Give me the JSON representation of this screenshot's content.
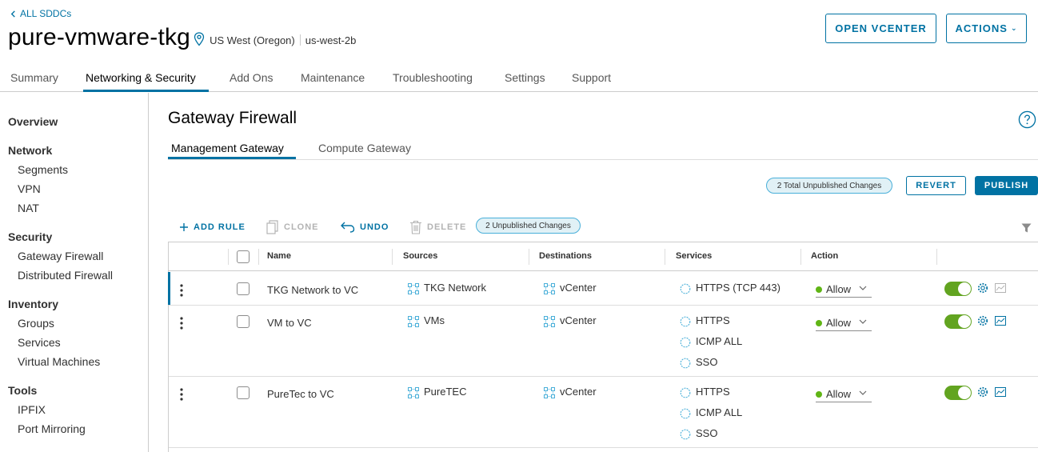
{
  "header": {
    "back_label": "ALL SDDCs",
    "sddc_name": "pure-vmware-tkg",
    "region": "US West (Oregon)",
    "az": "us-west-2b",
    "open_vcenter": "OPEN VCENTER",
    "actions": "ACTIONS"
  },
  "top_tabs": [
    "Summary",
    "Networking & Security",
    "Add Ons",
    "Maintenance",
    "Troubleshooting",
    "Settings",
    "Support"
  ],
  "sidebar": {
    "overview": "Overview",
    "network": {
      "heading": "Network",
      "items": [
        "Segments",
        "VPN",
        "NAT"
      ]
    },
    "security": {
      "heading": "Security",
      "items": [
        "Gateway Firewall",
        "Distributed Firewall"
      ]
    },
    "inventory": {
      "heading": "Inventory",
      "items": [
        "Groups",
        "Services",
        "Virtual Machines"
      ]
    },
    "tools": {
      "heading": "Tools",
      "items": [
        "IPFIX",
        "Port Mirroring"
      ]
    }
  },
  "main": {
    "title": "Gateway Firewall",
    "sub_tabs": [
      "Management Gateway",
      "Compute Gateway"
    ],
    "total_changes": "2 Total Unpublished Changes",
    "revert": "REVERT",
    "publish": "PUBLISH",
    "toolbar": {
      "add_rule": "ADD RULE",
      "clone": "CLONE",
      "undo": "UNDO",
      "delete": "DELETE",
      "unpublished": "2 Unpublished Changes"
    },
    "columns": [
      "Name",
      "Sources",
      "Destinations",
      "Services",
      "Action"
    ],
    "rules": [
      {
        "name": "TKG Network to VC",
        "source": "TKG Network",
        "destination": "vCenter",
        "services": [
          "HTTPS (TCP 443)"
        ],
        "action": "Allow",
        "enabled": true
      },
      {
        "name": "VM to VC",
        "source": "VMs",
        "destination": "vCenter",
        "services": [
          "HTTPS",
          "ICMP ALL",
          "SSO"
        ],
        "action": "Allow",
        "enabled": true
      },
      {
        "name": "PureTec to VC",
        "source": "PureTEC",
        "destination": "vCenter",
        "services": [
          "HTTPS",
          "ICMP ALL",
          "SSO"
        ],
        "action": "Allow",
        "enabled": true
      }
    ]
  },
  "colors": {
    "accent": "#0072a3",
    "allow": "#60b515",
    "toggle_on": "#62a420"
  }
}
